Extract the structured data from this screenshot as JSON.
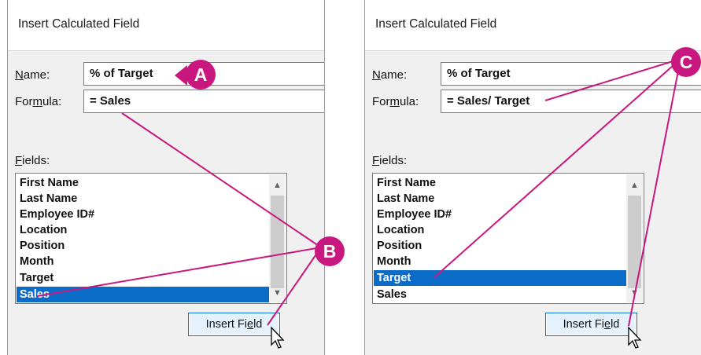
{
  "left_dialog": {
    "title": "Insert Calculated Field",
    "name_label_prefix": "N",
    "name_label_rest": "ame:",
    "name_value": "% of Target",
    "formula_label_pre": "For",
    "formula_label_ul": "m",
    "formula_label_post": "ula:",
    "formula_value": "= Sales",
    "fields_label_ul": "F",
    "fields_label_rest": "ields:",
    "fields": [
      "First Name",
      "Last Name",
      "Employee ID#",
      "Location",
      "Position",
      "Month",
      "Target",
      "Sales"
    ],
    "selected_field": "Sales",
    "insert_button_pre": "Insert Fi",
    "insert_button_ul": "e",
    "insert_button_post": "ld"
  },
  "right_dialog": {
    "title": "Insert Calculated Field",
    "name_label_prefix": "N",
    "name_label_rest": "ame:",
    "name_value": "% of Target",
    "formula_label_pre": "For",
    "formula_label_ul": "m",
    "formula_label_post": "ula:",
    "formula_value": "= Sales/ Target",
    "fields_label_ul": "F",
    "fields_label_rest": "ields:",
    "fields": [
      "First Name",
      "Last Name",
      "Employee ID#",
      "Location",
      "Position",
      "Month",
      "Target",
      "Sales"
    ],
    "selected_field": "Target",
    "insert_button_pre": "Insert Fi",
    "insert_button_ul": "e",
    "insert_button_post": "ld"
  },
  "callouts": {
    "a": "A",
    "b": "B",
    "c": "C"
  },
  "colors": {
    "callout": "#c8177e",
    "selection": "#0a6cc7",
    "button_border": "#0078d7"
  }
}
